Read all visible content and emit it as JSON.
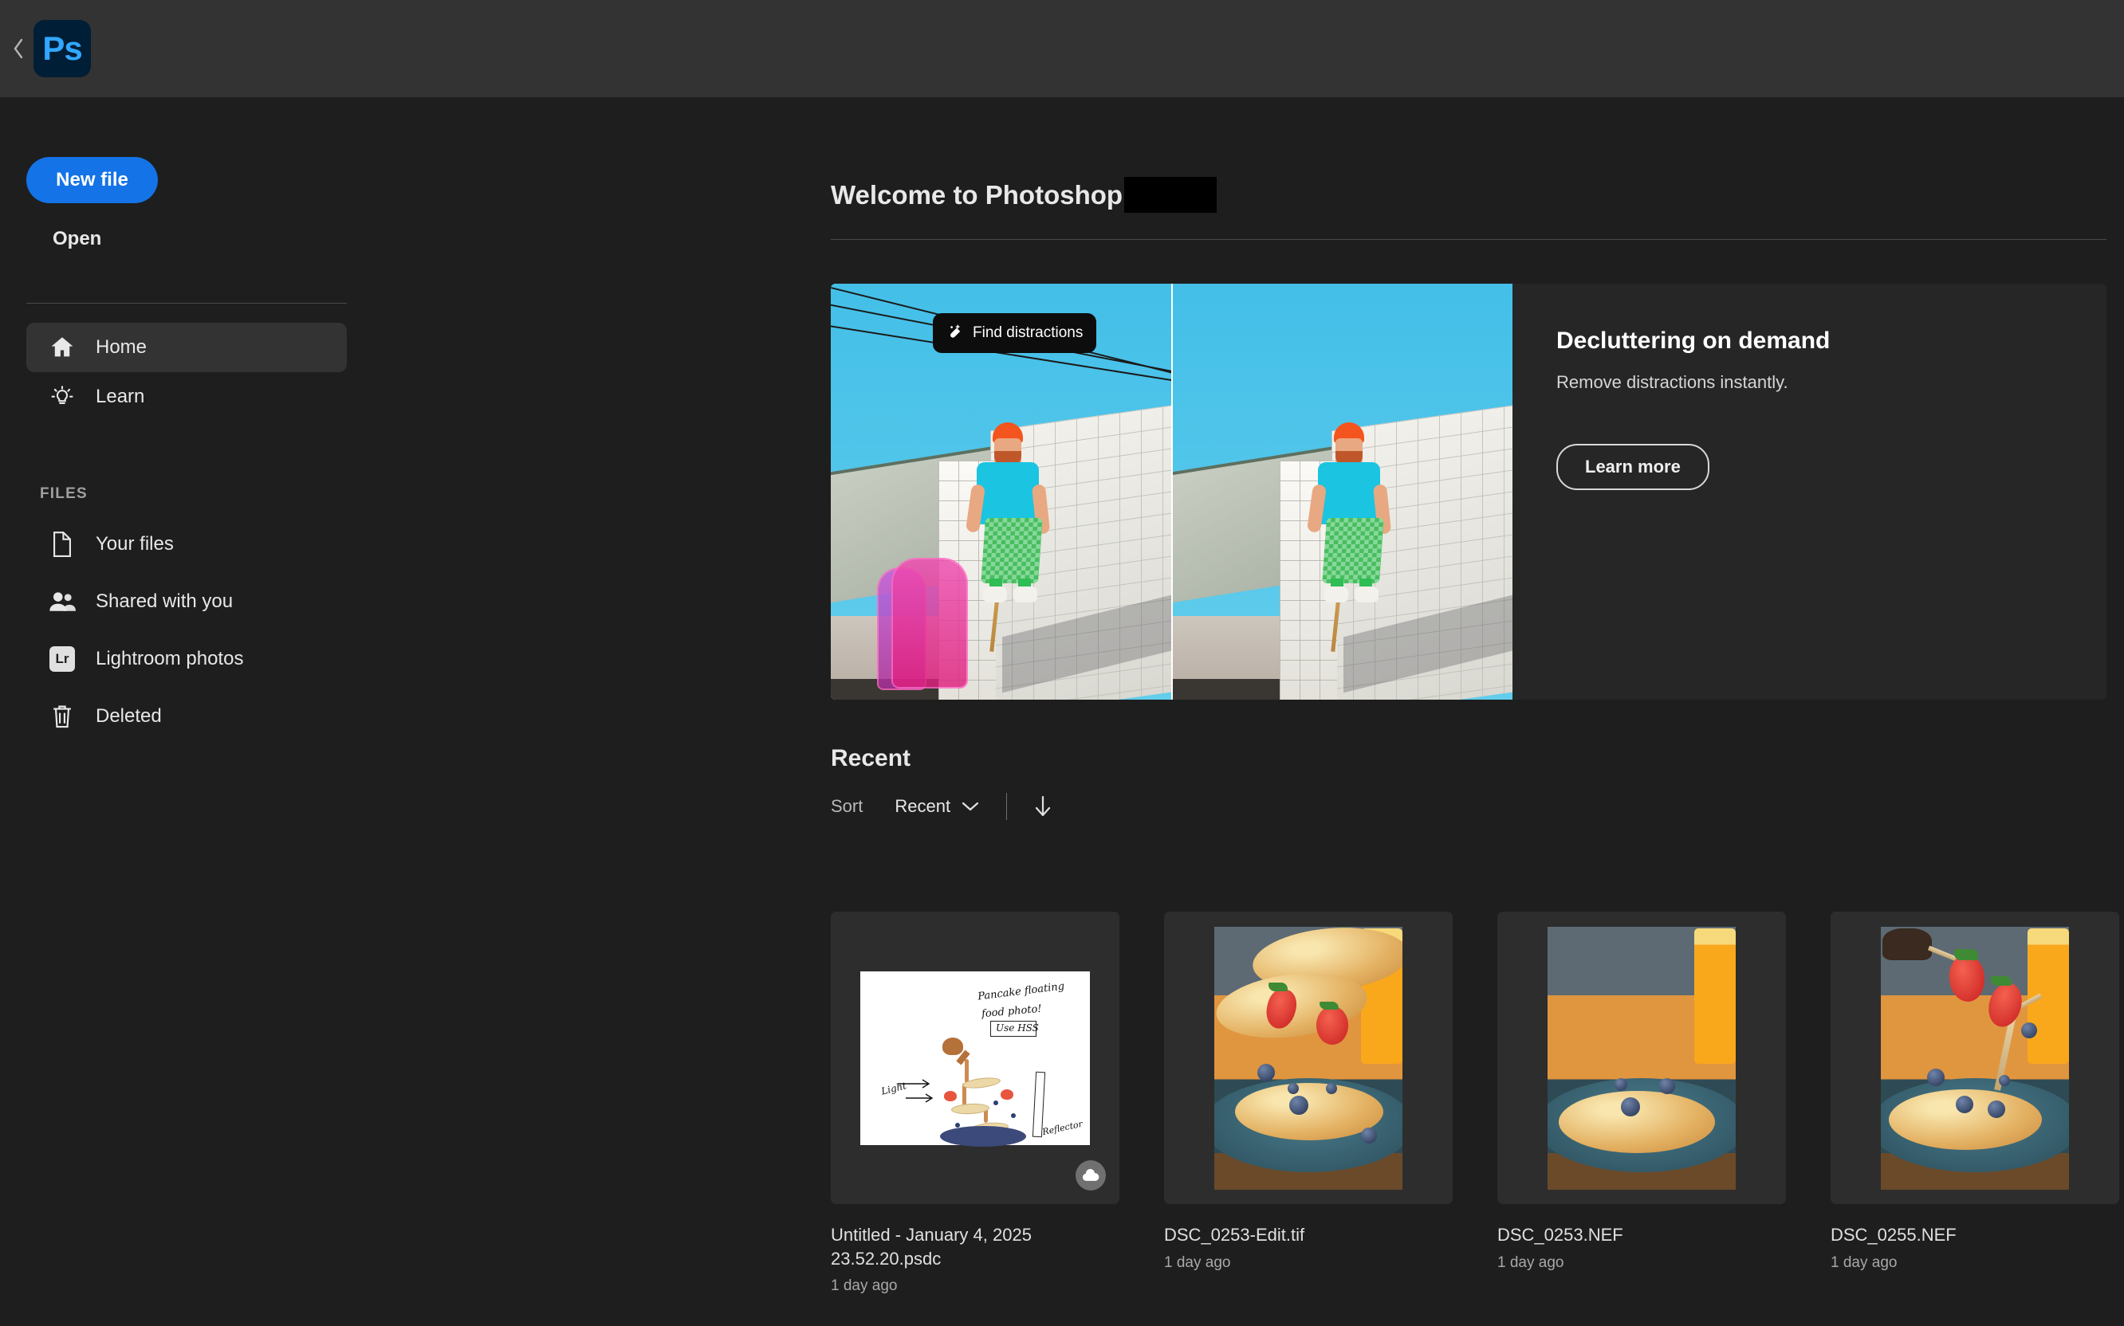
{
  "titlebar": {
    "back_icon": "chevron-left-icon",
    "app_logo_text": "Ps",
    "app_logo_bg": "#001e36",
    "app_logo_fg": "#31a8ff"
  },
  "sidebar": {
    "new_file_label": "New file",
    "new_file_color": "#1473e6",
    "open_label": "Open",
    "nav": [
      {
        "label": "Home",
        "icon": "home-icon",
        "active": true
      },
      {
        "label": "Learn",
        "icon": "lightbulb-icon",
        "active": false
      }
    ],
    "files_section_label": "FILES",
    "files": [
      {
        "label": "Your files",
        "icon": "document-icon"
      },
      {
        "label": "Shared with you",
        "icon": "people-icon"
      },
      {
        "label": "Lightroom photos",
        "icon": "lightroom-icon",
        "badge_text": "Lr"
      },
      {
        "label": "Deleted",
        "icon": "trash-icon"
      }
    ]
  },
  "main": {
    "welcome_title": "Welcome to Photoshop",
    "welcome_redacted": true,
    "hero": {
      "badge_label": "Find distractions",
      "badge_icon": "spot-healing-brush-icon",
      "title": "Decluttering on demand",
      "subtitle": "Remove distractions instantly.",
      "cta_label": "Learn more"
    },
    "recent": {
      "heading": "Recent",
      "sort_label": "Sort",
      "sort_value": "Recent",
      "sort_chevron_icon": "chevron-down-icon",
      "sort_direction_icon": "arrow-down-icon",
      "files": [
        {
          "name": "Untitled - January 4, 2025 23.52.20.psdc",
          "time": "1 day ago",
          "thumb": "sketch",
          "cloud_badge": true,
          "sketch_text": {
            "title_line1": "Pancake floating",
            "title_line2": "food photo!",
            "boxed_note": "Use HSS",
            "light_label": "Light",
            "reflector_label": "Reflector"
          }
        },
        {
          "name": "DSC_0253-Edit.tif",
          "time": "1 day ago",
          "thumb": "pancakes-floating",
          "cloud_badge": false
        },
        {
          "name": "DSC_0253.NEF",
          "time": "1 day ago",
          "thumb": "pancake-plain",
          "cloud_badge": false
        },
        {
          "name": "DSC_0255.NEF",
          "time": "1 day ago",
          "thumb": "pancake-skewers",
          "cloud_badge": false
        }
      ]
    }
  }
}
